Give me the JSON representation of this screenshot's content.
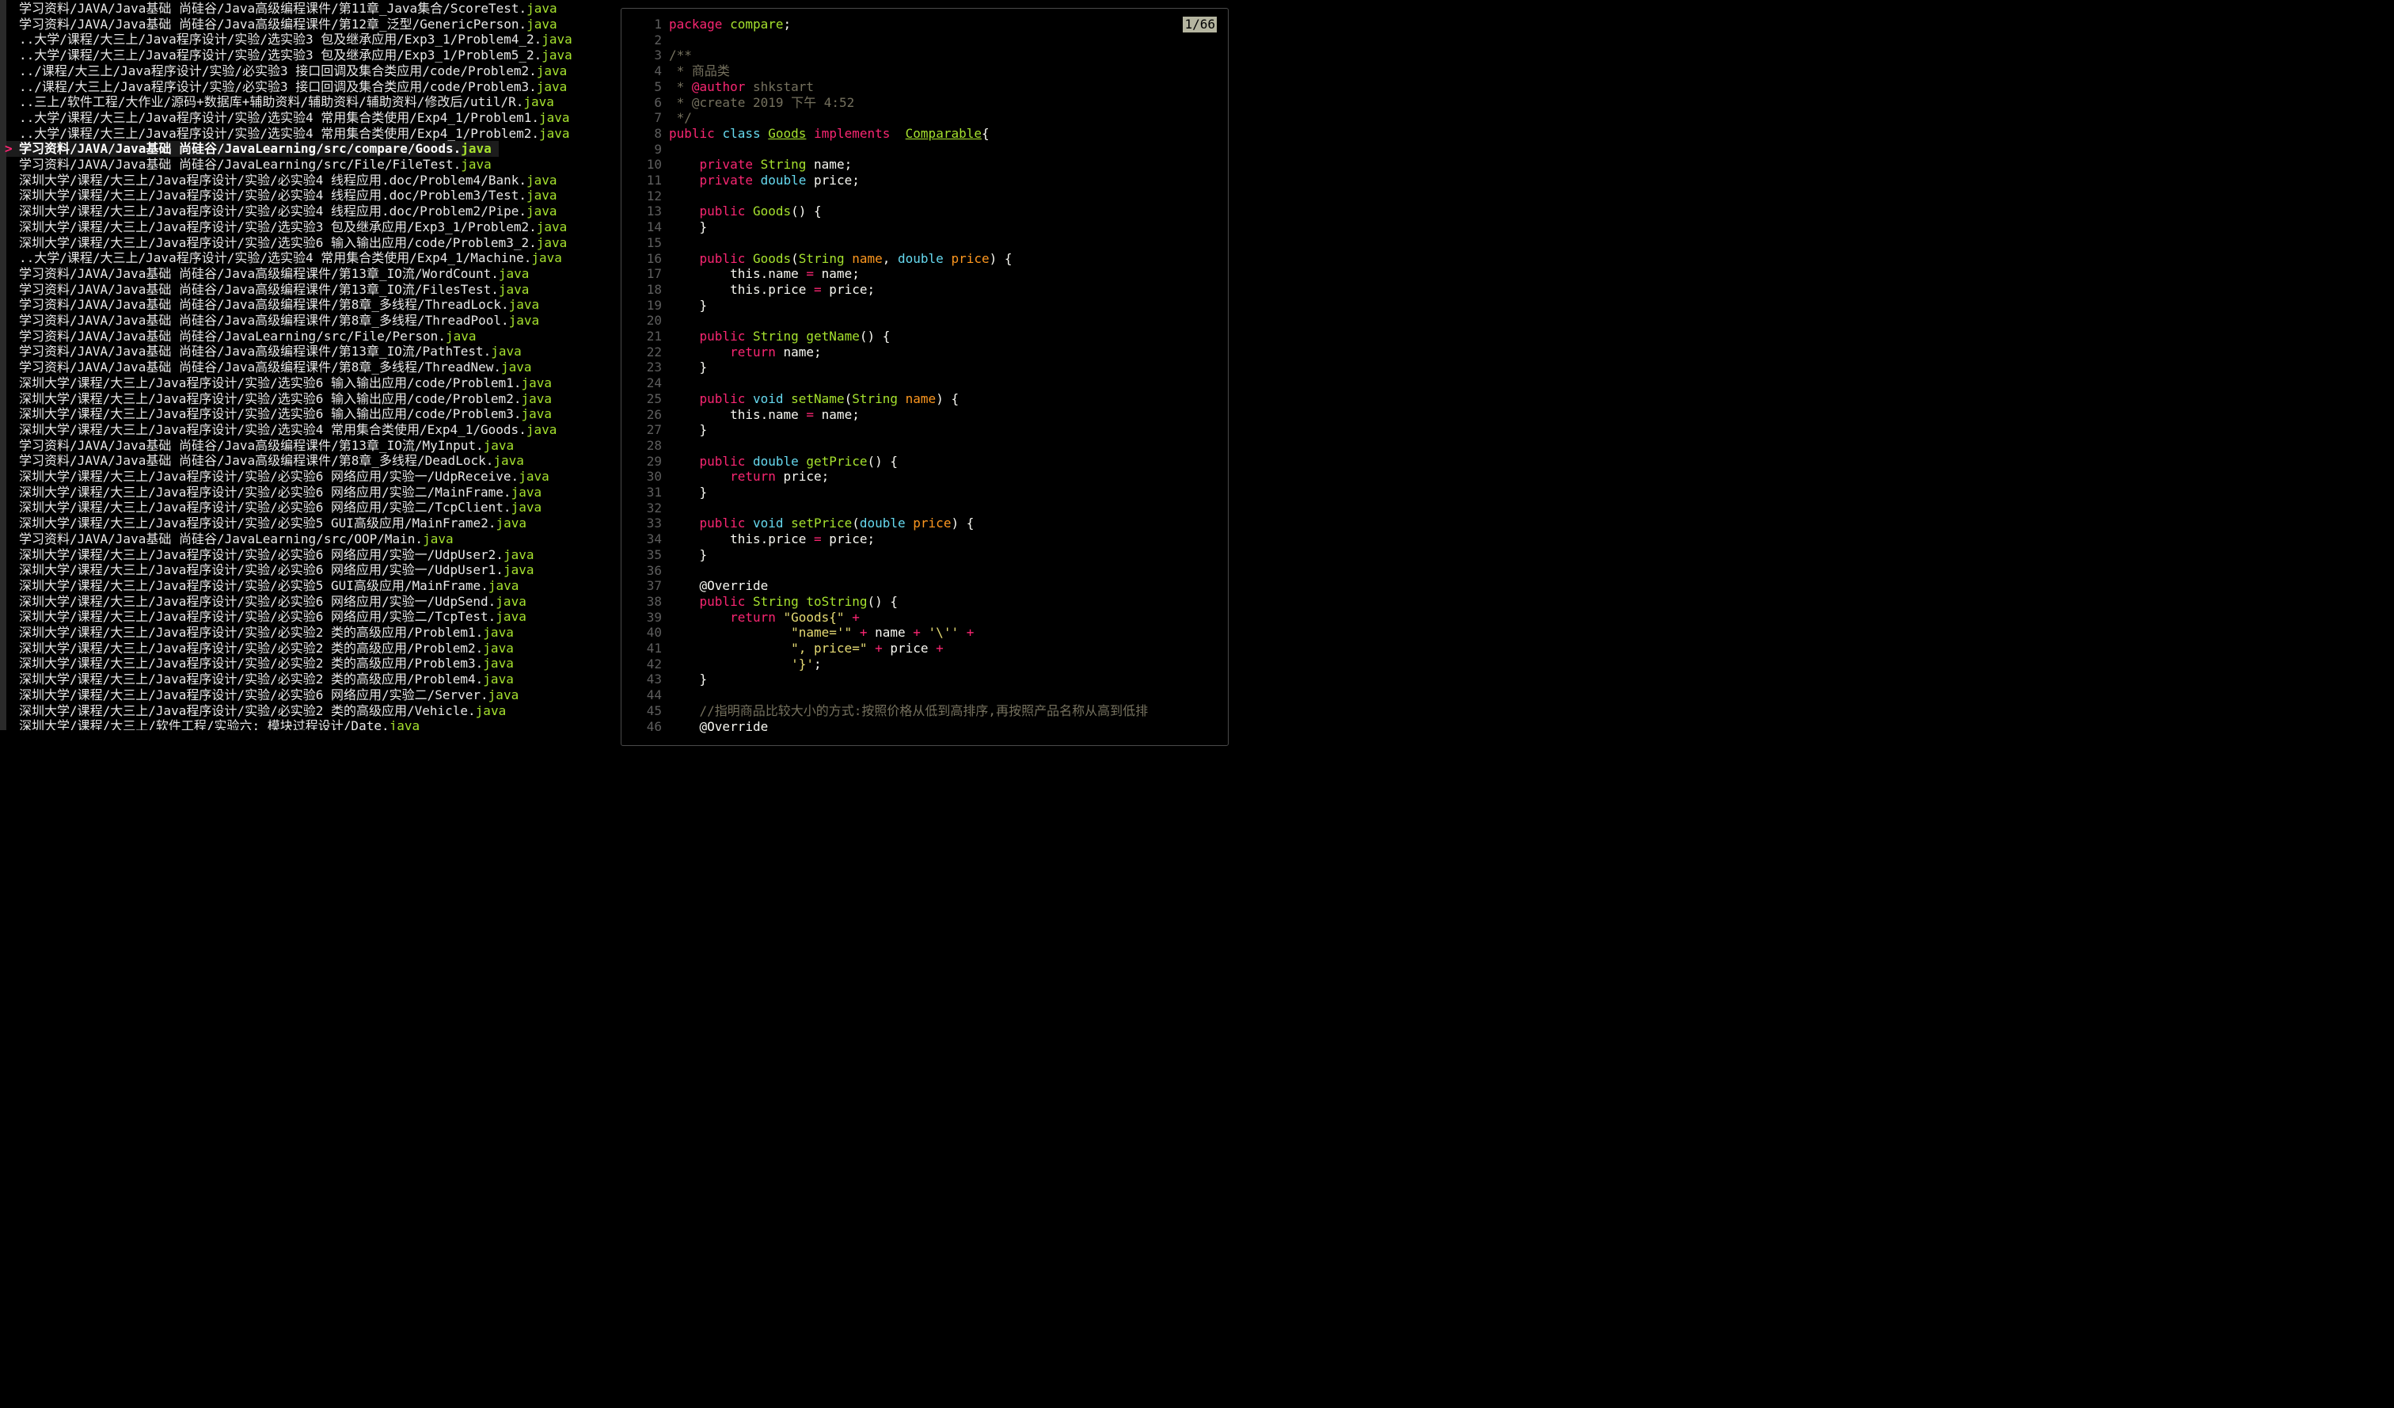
{
  "file_list": {
    "selected_index": 9,
    "marker": ">",
    "items": [
      {
        "path": "学习资料/JAVA/Java基础 尚硅谷/Java高级编程课件/第11章_Java集合/ScoreTest.",
        "ext": "java"
      },
      {
        "path": "学习资料/JAVA/Java基础 尚硅谷/Java高级编程课件/第12章_泛型/GenericPerson.",
        "ext": "java"
      },
      {
        "path": "..大学/课程/大三上/Java程序设计/实验/选实验3 包及继承应用/Exp3_1/Problem4_2.",
        "ext": "java"
      },
      {
        "path": "..大学/课程/大三上/Java程序设计/实验/选实验3 包及继承应用/Exp3_1/Problem5_2.",
        "ext": "java"
      },
      {
        "path": "../课程/大三上/Java程序设计/实验/必实验3 接口回调及集合类应用/code/Problem2.",
        "ext": "java"
      },
      {
        "path": "../课程/大三上/Java程序设计/实验/必实验3 接口回调及集合类应用/code/Problem3.",
        "ext": "java"
      },
      {
        "path": "..三上/软件工程/大作业/源码+数据库+辅助资料/辅助资料/辅助资料/修改后/util/R.",
        "ext": "java"
      },
      {
        "path": "..大学/课程/大三上/Java程序设计/实验/选实验4 常用集合类使用/Exp4_1/Problem1.",
        "ext": "java"
      },
      {
        "path": "..大学/课程/大三上/Java程序设计/实验/选实验4 常用集合类使用/Exp4_1/Problem2.",
        "ext": "java"
      },
      {
        "path": "学习资料/JAVA/Java基础 尚硅谷/JavaLearning/src/compare/Goods.",
        "ext": "java"
      },
      {
        "path": "学习资料/JAVA/Java基础 尚硅谷/JavaLearning/src/File/FileTest.",
        "ext": "java"
      },
      {
        "path": "深圳大学/课程/大三上/Java程序设计/实验/必实验4 线程应用.doc/Problem4/Bank.",
        "ext": "java"
      },
      {
        "path": "深圳大学/课程/大三上/Java程序设计/实验/必实验4 线程应用.doc/Problem3/Test.",
        "ext": "java"
      },
      {
        "path": "深圳大学/课程/大三上/Java程序设计/实验/必实验4 线程应用.doc/Problem2/Pipe.",
        "ext": "java"
      },
      {
        "path": "深圳大学/课程/大三上/Java程序设计/实验/选实验3 包及继承应用/Exp3_1/Problem2.",
        "ext": "java"
      },
      {
        "path": "深圳大学/课程/大三上/Java程序设计/实验/选实验6 输入输出应用/code/Problem3_2.",
        "ext": "java"
      },
      {
        "path": "..大学/课程/大三上/Java程序设计/实验/选实验4 常用集合类使用/Exp4_1/Machine.",
        "ext": "java"
      },
      {
        "path": "学习资料/JAVA/Java基础 尚硅谷/Java高级编程课件/第13章_IO流/WordCount.",
        "ext": "java"
      },
      {
        "path": "学习资料/JAVA/Java基础 尚硅谷/Java高级编程课件/第13章_IO流/FilesTest.",
        "ext": "java"
      },
      {
        "path": "学习资料/JAVA/Java基础 尚硅谷/Java高级编程课件/第8章_多线程/ThreadLock.",
        "ext": "java"
      },
      {
        "path": "学习资料/JAVA/Java基础 尚硅谷/Java高级编程课件/第8章_多线程/ThreadPool.",
        "ext": "java"
      },
      {
        "path": "学习资料/JAVA/Java基础 尚硅谷/JavaLearning/src/File/Person.",
        "ext": "java"
      },
      {
        "path": "学习资料/JAVA/Java基础 尚硅谷/Java高级编程课件/第13章_IO流/PathTest.",
        "ext": "java"
      },
      {
        "path": "学习资料/JAVA/Java基础 尚硅谷/Java高级编程课件/第8章_多线程/ThreadNew.",
        "ext": "java"
      },
      {
        "path": "深圳大学/课程/大三上/Java程序设计/实验/选实验6 输入输出应用/code/Problem1.",
        "ext": "java"
      },
      {
        "path": "深圳大学/课程/大三上/Java程序设计/实验/选实验6 输入输出应用/code/Problem2.",
        "ext": "java"
      },
      {
        "path": "深圳大学/课程/大三上/Java程序设计/实验/选实验6 输入输出应用/code/Problem3.",
        "ext": "java"
      },
      {
        "path": "深圳大学/课程/大三上/Java程序设计/实验/选实验4 常用集合类使用/Exp4_1/Goods.",
        "ext": "java"
      },
      {
        "path": "学习资料/JAVA/Java基础 尚硅谷/Java高级编程课件/第13章_IO流/MyInput.",
        "ext": "java"
      },
      {
        "path": "学习资料/JAVA/Java基础 尚硅谷/Java高级编程课件/第8章_多线程/DeadLock.",
        "ext": "java"
      },
      {
        "path": "深圳大学/课程/大三上/Java程序设计/实验/必实验6 网络应用/实验一/UdpReceive.",
        "ext": "java"
      },
      {
        "path": "深圳大学/课程/大三上/Java程序设计/实验/必实验6 网络应用/实验二/MainFrame.",
        "ext": "java"
      },
      {
        "path": "深圳大学/课程/大三上/Java程序设计/实验/必实验6 网络应用/实验二/TcpClient.",
        "ext": "java"
      },
      {
        "path": "深圳大学/课程/大三上/Java程序设计/实验/必实验5 GUI高级应用/MainFrame2.",
        "ext": "java"
      },
      {
        "path": "学习资料/JAVA/Java基础 尚硅谷/JavaLearning/src/OOP/Main.",
        "ext": "java"
      },
      {
        "path": "深圳大学/课程/大三上/Java程序设计/实验/必实验6 网络应用/实验一/UdpUser2.",
        "ext": "java"
      },
      {
        "path": "深圳大学/课程/大三上/Java程序设计/实验/必实验6 网络应用/实验一/UdpUser1.",
        "ext": "java"
      },
      {
        "path": "深圳大学/课程/大三上/Java程序设计/实验/必实验5 GUI高级应用/MainFrame.",
        "ext": "java"
      },
      {
        "path": "深圳大学/课程/大三上/Java程序设计/实验/必实验6 网络应用/实验一/UdpSend.",
        "ext": "java"
      },
      {
        "path": "深圳大学/课程/大三上/Java程序设计/实验/必实验6 网络应用/实验二/TcpTest.",
        "ext": "java"
      },
      {
        "path": "深圳大学/课程/大三上/Java程序设计/实验/必实验2 类的高级应用/Problem1.",
        "ext": "java"
      },
      {
        "path": "深圳大学/课程/大三上/Java程序设计/实验/必实验2 类的高级应用/Problem2.",
        "ext": "java"
      },
      {
        "path": "深圳大学/课程/大三上/Java程序设计/实验/必实验2 类的高级应用/Problem3.",
        "ext": "java"
      },
      {
        "path": "深圳大学/课程/大三上/Java程序设计/实验/必实验2 类的高级应用/Problem4.",
        "ext": "java"
      },
      {
        "path": "深圳大学/课程/大三上/Java程序设计/实验/必实验6 网络应用/实验二/Server.",
        "ext": "java"
      },
      {
        "path": "深圳大学/课程/大三上/Java程序设计/实验/必实验2 类的高级应用/Vehicle.",
        "ext": "java"
      },
      {
        "path": "深圳大学/课程/大三上/软件工程/实验六: 模块过程设计/Date.",
        "ext": "java"
      }
    ]
  },
  "preview": {
    "position_indicator": "1/66",
    "lines": [
      {
        "n": "1",
        "t": [
          [
            "kw",
            "package"
          ],
          [
            "pl",
            " "
          ],
          [
            "fn",
            "compare"
          ],
          [
            "pl",
            ";"
          ]
        ]
      },
      {
        "n": "2",
        "t": []
      },
      {
        "n": "3",
        "t": [
          [
            "cm",
            "/**"
          ]
        ]
      },
      {
        "n": "4",
        "t": [
          [
            "cm",
            " * 商品类"
          ]
        ]
      },
      {
        "n": "5",
        "t": [
          [
            "cm",
            " * "
          ],
          [
            "cmk",
            "@author"
          ],
          [
            "cm",
            " shkstart"
          ]
        ]
      },
      {
        "n": "6",
        "t": [
          [
            "cm",
            " * @create 2019 下午 4:52"
          ]
        ]
      },
      {
        "n": "7",
        "t": [
          [
            "cm",
            " */"
          ]
        ]
      },
      {
        "n": "8",
        "t": [
          [
            "kw",
            "public"
          ],
          [
            "pl",
            " "
          ],
          [
            "ty",
            "class"
          ],
          [
            "pl",
            " "
          ],
          [
            "fn ul",
            "Goods"
          ],
          [
            "pl",
            " "
          ],
          [
            "kw",
            "implements"
          ],
          [
            "pl",
            "  "
          ],
          [
            "fn ul",
            "Comparable"
          ],
          [
            "pl",
            "{"
          ]
        ]
      },
      {
        "n": "9",
        "t": []
      },
      {
        "n": "10",
        "t": [
          [
            "pl",
            "    "
          ],
          [
            "kw",
            "private"
          ],
          [
            "pl",
            " "
          ],
          [
            "fn",
            "String"
          ],
          [
            "pl",
            " name;"
          ]
        ]
      },
      {
        "n": "11",
        "t": [
          [
            "pl",
            "    "
          ],
          [
            "kw",
            "private"
          ],
          [
            "pl",
            " "
          ],
          [
            "ty",
            "double"
          ],
          [
            "pl",
            " price;"
          ]
        ]
      },
      {
        "n": "12",
        "t": []
      },
      {
        "n": "13",
        "t": [
          [
            "pl",
            "    "
          ],
          [
            "kw",
            "public"
          ],
          [
            "pl",
            " "
          ],
          [
            "fn",
            "Goods"
          ],
          [
            "pl",
            "() {"
          ]
        ]
      },
      {
        "n": "14",
        "t": [
          [
            "pl",
            "    }"
          ]
        ]
      },
      {
        "n": "15",
        "t": []
      },
      {
        "n": "16",
        "t": [
          [
            "pl",
            "    "
          ],
          [
            "kw",
            "public"
          ],
          [
            "pl",
            " "
          ],
          [
            "fn",
            "Goods"
          ],
          [
            "pl",
            "("
          ],
          [
            "fn",
            "String"
          ],
          [
            "pl",
            " "
          ],
          [
            "pa",
            "name"
          ],
          [
            "pl",
            ", "
          ],
          [
            "ty",
            "double"
          ],
          [
            "pl",
            " "
          ],
          [
            "pa",
            "price"
          ],
          [
            "pl",
            ") {"
          ]
        ]
      },
      {
        "n": "17",
        "t": [
          [
            "pl",
            "        this.name "
          ],
          [
            "op",
            "="
          ],
          [
            "pl",
            " name;"
          ]
        ]
      },
      {
        "n": "18",
        "t": [
          [
            "pl",
            "        this.price "
          ],
          [
            "op",
            "="
          ],
          [
            "pl",
            " price;"
          ]
        ]
      },
      {
        "n": "19",
        "t": [
          [
            "pl",
            "    }"
          ]
        ]
      },
      {
        "n": "20",
        "t": []
      },
      {
        "n": "21",
        "t": [
          [
            "pl",
            "    "
          ],
          [
            "kw",
            "public"
          ],
          [
            "pl",
            " "
          ],
          [
            "fn",
            "String"
          ],
          [
            "pl",
            " "
          ],
          [
            "fn",
            "getName"
          ],
          [
            "pl",
            "() {"
          ]
        ]
      },
      {
        "n": "22",
        "t": [
          [
            "pl",
            "        "
          ],
          [
            "kw",
            "return"
          ],
          [
            "pl",
            " name;"
          ]
        ]
      },
      {
        "n": "23",
        "t": [
          [
            "pl",
            "    }"
          ]
        ]
      },
      {
        "n": "24",
        "t": []
      },
      {
        "n": "25",
        "t": [
          [
            "pl",
            "    "
          ],
          [
            "kw",
            "public"
          ],
          [
            "pl",
            " "
          ],
          [
            "ty",
            "void"
          ],
          [
            "pl",
            " "
          ],
          [
            "fn",
            "setName"
          ],
          [
            "pl",
            "("
          ],
          [
            "fn",
            "String"
          ],
          [
            "pl",
            " "
          ],
          [
            "pa",
            "name"
          ],
          [
            "pl",
            ") {"
          ]
        ]
      },
      {
        "n": "26",
        "t": [
          [
            "pl",
            "        this.name "
          ],
          [
            "op",
            "="
          ],
          [
            "pl",
            " name;"
          ]
        ]
      },
      {
        "n": "27",
        "t": [
          [
            "pl",
            "    }"
          ]
        ]
      },
      {
        "n": "28",
        "t": []
      },
      {
        "n": "29",
        "t": [
          [
            "pl",
            "    "
          ],
          [
            "kw",
            "public"
          ],
          [
            "pl",
            " "
          ],
          [
            "ty",
            "double"
          ],
          [
            "pl",
            " "
          ],
          [
            "fn",
            "getPrice"
          ],
          [
            "pl",
            "() {"
          ]
        ]
      },
      {
        "n": "30",
        "t": [
          [
            "pl",
            "        "
          ],
          [
            "kw",
            "return"
          ],
          [
            "pl",
            " price;"
          ]
        ]
      },
      {
        "n": "31",
        "t": [
          [
            "pl",
            "    }"
          ]
        ]
      },
      {
        "n": "32",
        "t": []
      },
      {
        "n": "33",
        "t": [
          [
            "pl",
            "    "
          ],
          [
            "kw",
            "public"
          ],
          [
            "pl",
            " "
          ],
          [
            "ty",
            "void"
          ],
          [
            "pl",
            " "
          ],
          [
            "fn",
            "setPrice"
          ],
          [
            "pl",
            "("
          ],
          [
            "ty",
            "double"
          ],
          [
            "pl",
            " "
          ],
          [
            "pa",
            "price"
          ],
          [
            "pl",
            ") {"
          ]
        ]
      },
      {
        "n": "34",
        "t": [
          [
            "pl",
            "        this.price "
          ],
          [
            "op",
            "="
          ],
          [
            "pl",
            " price;"
          ]
        ]
      },
      {
        "n": "35",
        "t": [
          [
            "pl",
            "    }"
          ]
        ]
      },
      {
        "n": "36",
        "t": []
      },
      {
        "n": "37",
        "t": [
          [
            "pl",
            "    @Override"
          ]
        ]
      },
      {
        "n": "38",
        "t": [
          [
            "pl",
            "    "
          ],
          [
            "kw",
            "public"
          ],
          [
            "pl",
            " "
          ],
          [
            "fn",
            "String"
          ],
          [
            "pl",
            " "
          ],
          [
            "fn",
            "toString"
          ],
          [
            "pl",
            "() {"
          ]
        ]
      },
      {
        "n": "39",
        "t": [
          [
            "pl",
            "        "
          ],
          [
            "kw",
            "return"
          ],
          [
            "pl",
            " "
          ],
          [
            "st",
            "\"Goods{\""
          ],
          [
            "pl",
            " "
          ],
          [
            "op",
            "+"
          ]
        ]
      },
      {
        "n": "40",
        "t": [
          [
            "pl",
            "                "
          ],
          [
            "st",
            "\"name='\""
          ],
          [
            "pl",
            " "
          ],
          [
            "op",
            "+"
          ],
          [
            "pl",
            " name "
          ],
          [
            "op",
            "+"
          ],
          [
            "pl",
            " "
          ],
          [
            "st",
            "'\\''"
          ],
          [
            "pl",
            " "
          ],
          [
            "op",
            "+"
          ]
        ]
      },
      {
        "n": "41",
        "t": [
          [
            "pl",
            "                "
          ],
          [
            "st",
            "\", price=\""
          ],
          [
            "pl",
            " "
          ],
          [
            "op",
            "+"
          ],
          [
            "pl",
            " price "
          ],
          [
            "op",
            "+"
          ]
        ]
      },
      {
        "n": "42",
        "t": [
          [
            "pl",
            "                "
          ],
          [
            "st",
            "'}'"
          ],
          [
            "pl",
            ";"
          ]
        ]
      },
      {
        "n": "43",
        "t": [
          [
            "pl",
            "    }"
          ]
        ]
      },
      {
        "n": "44",
        "t": []
      },
      {
        "n": "45",
        "t": [
          [
            "pl",
            "    "
          ],
          [
            "cm",
            "//指明商品比较大小的方式:按照价格从低到高排序,再按照产品名称从高到低排"
          ]
        ]
      },
      {
        "n": "46",
        "t": [
          [
            "pl",
            "    @Override"
          ]
        ]
      }
    ]
  }
}
